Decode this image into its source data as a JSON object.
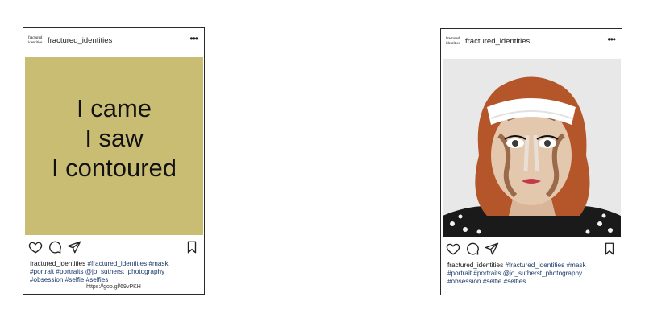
{
  "posts": [
    {
      "username": "fractured_identities",
      "avatar_text": [
        "fractured",
        "identities"
      ],
      "more_label": "•••",
      "quote_lines": [
        "I came",
        "I saw",
        "I contoured"
      ],
      "caption": {
        "user": "fractured_identities",
        "line1": "#fractured_identities #mask",
        "line2": "#portrait #portraits @jo_sutherst_photography",
        "line3": "#obsession #selfie #selfies"
      },
      "short_link": "https://goo.gl/69vPKH",
      "media_color": "#c9bc73"
    },
    {
      "username": "fractured_identities",
      "avatar_text": [
        "fractured",
        "identities"
      ],
      "more_label": "•••",
      "caption": {
        "user": "fractured_identities",
        "line1": "#fractured_identities #mask",
        "line2": "#portrait #portraits @jo_sutherst_photography",
        "line3": "#obsession #selfie #selfies"
      }
    }
  ],
  "icons": [
    "heart-icon",
    "comment-icon",
    "share-icon",
    "bookmark-icon"
  ]
}
